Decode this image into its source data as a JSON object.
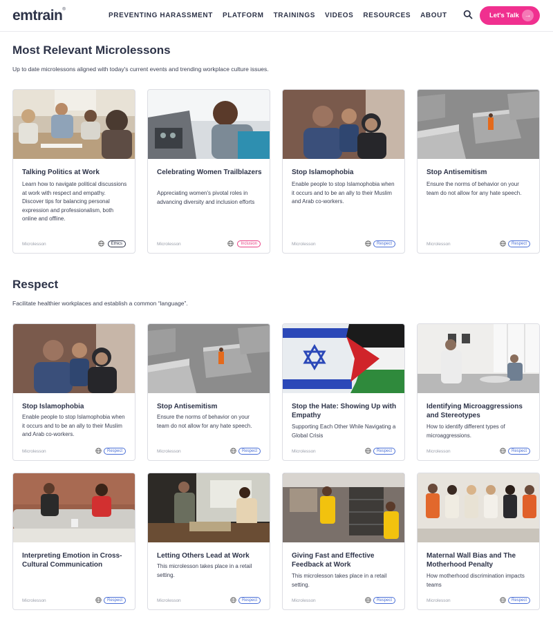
{
  "nav": {
    "logo": "emtrain",
    "logo_mark": "®",
    "items": [
      "PREVENTING HARASSMENT",
      "PLATFORM",
      "TRAININGS",
      "VIDEOS",
      "RESOURCES",
      "ABOUT"
    ],
    "cta_label": "Let's Talk",
    "cta_arrow": "→",
    "brand_color": "#f0308f"
  },
  "sections": [
    {
      "title": "Most Relevant Microlessons",
      "subtitle": "Up to date microlessons aligned with today's current events and trending workplace culture issues."
    },
    {
      "title": "Respect",
      "subtitle": "Facilitate healthier workplaces and establish a common “language”."
    }
  ],
  "cards": [
    {
      "title": "Talking Politics at Work",
      "desc": "Learn how to navigate political discussions at work with respect and empathy. Discover tips for balancing personal expression and professionalism, both online and offline.",
      "type": "Microlesson",
      "tag": "Ethics",
      "image": "office-meeting-photo"
    },
    {
      "title": "Celebrating Women Trailblazers",
      "desc": "Appreciating women's pivotal roles in advancing diversity and inclusion efforts",
      "type": "Microlesson",
      "tag": "Inclusion",
      "image": "pilot-cockpit-photo"
    },
    {
      "title": "Stop Islamophobia",
      "desc": "Enable people to stop Islamophobia when it occurs and to be an ally to their Muslim and Arab co-workers.",
      "type": "Microlesson",
      "tag": "Respect",
      "image": "family-portrait-photo"
    },
    {
      "title": "Stop Antisemitism",
      "desc": "Ensure the norms of behavior on your team do not allow for any hate speech.",
      "type": "Microlesson",
      "tag": "Respect",
      "image": "memorial-blocks-photo"
    },
    {
      "title": "Stop Islamophobia",
      "desc": "Enable people to stop Islamophobia when it occurs and to be an ally to their Muslim and Arab co-workers.",
      "type": "Microlesson",
      "tag": "Respect",
      "image": "family-portrait-photo"
    },
    {
      "title": "Stop Antisemitism",
      "desc": "Ensure the norms of behavior on your team do not allow for any hate speech.",
      "type": "Microlesson",
      "tag": "Respect",
      "image": "memorial-blocks-photo"
    },
    {
      "title": "Stop the Hate: Showing Up with Empathy",
      "desc": "Supporting Each Other While Navigating a Global Crisis",
      "type": "Microlesson",
      "tag": "Respect",
      "image": "flags-photo"
    },
    {
      "title": "Identifying Microaggressions and Stereotypes",
      "desc": "How to identify different types of microaggressions.",
      "type": "Microlesson",
      "tag": "Respect",
      "image": "breakroom-photo"
    },
    {
      "title": "Interpreting Emotion in Cross-Cultural Communication",
      "desc": "",
      "type": "Microlesson",
      "tag": "Respect",
      "image": "living-room-photo"
    },
    {
      "title": "Letting Others Lead at Work",
      "desc": "This microlesson takes place in a retail setting.",
      "type": "Microlesson",
      "tag": "Respect",
      "image": "market-photo"
    },
    {
      "title": "Giving Fast and Effective Feedback at Work",
      "desc": "This microlesson takes place in a retail setting.",
      "type": "Microlesson",
      "tag": "Respect",
      "image": "stockroom-photo"
    },
    {
      "title": "Maternal Wall Bias and The Motherhood Penalty",
      "desc": "How motherhood discrimination impacts teams",
      "type": "Microlesson",
      "tag": "Respect",
      "image": "panel-women-photo"
    }
  ],
  "colors": {
    "text": "#2d3348",
    "tag_blue": "#4a6fd6",
    "tag_pink": "#e93f83"
  }
}
